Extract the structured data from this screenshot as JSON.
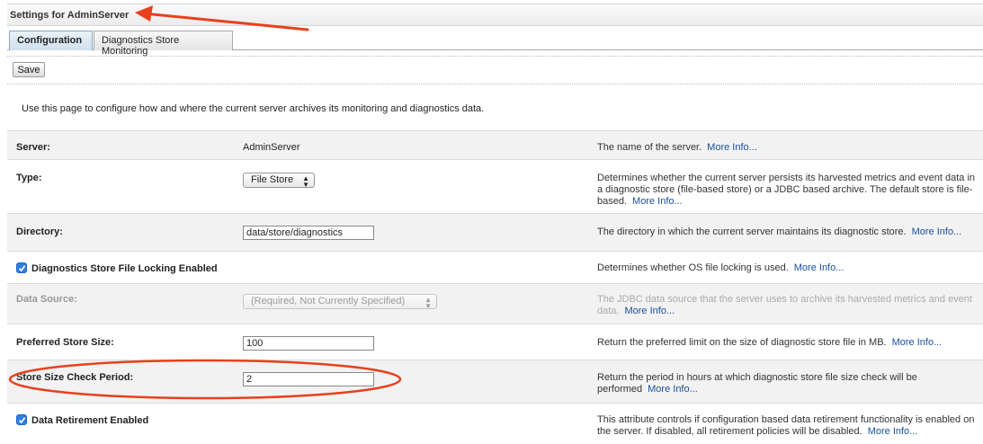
{
  "header": {
    "title": "Settings for AdminServer"
  },
  "tabs": [
    {
      "label": "Configuration",
      "active": true
    },
    {
      "label": "Diagnostics Store Monitoring",
      "active": false
    }
  ],
  "toolbar": {
    "save_label": "Save"
  },
  "intro": "Use this page to configure how and where the current server archives its monitoring and diagnostics data.",
  "more_info": "More Info...",
  "fields": {
    "server": {
      "label": "Server:",
      "value": "AdminServer",
      "desc": "The name of the server."
    },
    "type": {
      "label": "Type:",
      "value": "File Store",
      "desc": "Determines whether the current server persists its harvested metrics and event data in a diagnostic store (file-based store) or a JDBC based archive. The default store is file-based."
    },
    "directory": {
      "label": "Directory:",
      "value": "data/store/diagnostics",
      "desc": "The directory in which the current server maintains its diagnostic store."
    },
    "file_locking": {
      "label": "Diagnostics Store File Locking Enabled",
      "checked": true,
      "desc": "Determines whether OS file locking is used."
    },
    "data_source": {
      "label": "Data Source:",
      "value": "(Required, Not Currently Specified)",
      "disabled": true,
      "desc": "The JDBC data source that the server uses to archive its harvested metrics and event data."
    },
    "preferred_size": {
      "label": "Preferred Store Size:",
      "value": "100",
      "desc": "Return the preferred limit on the size of diagnostic store file in MB."
    },
    "check_period": {
      "label": "Store Size Check Period:",
      "value": "2",
      "desc": "Return the period in hours at which diagnostic store file size check will be performed"
    },
    "data_retirement": {
      "label": "Data Retirement Enabled",
      "checked": true,
      "desc": "This attribute controls if configuration based data retirement functionality is enabled on the server. If disabled, all retirement policies will be disabled."
    }
  },
  "colors": {
    "annotation": "#e8401c",
    "link": "#1a4f9c",
    "checkbox": "#2b7de1"
  }
}
